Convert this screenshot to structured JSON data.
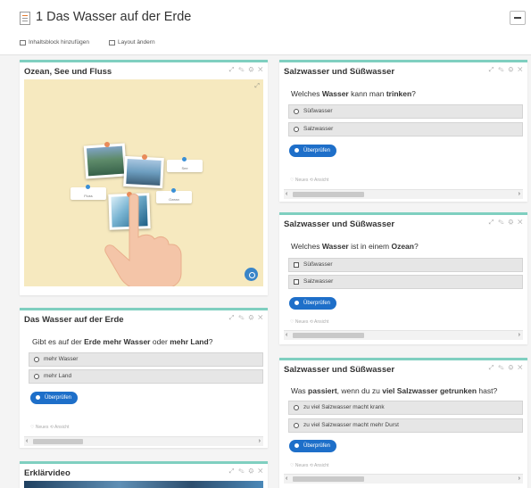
{
  "header": {
    "title": "1 Das Wasser auf der Erde",
    "add_block_label": "Inhaltsblock hinzufügen",
    "change_layout_label": "Layout ändern"
  },
  "card_tools_glyphs": "⤢ ✎ ⚙ ✕",
  "common": {
    "check_label": "Überprüfen",
    "meta_label": "♡ Neues   ⟲ Ansicht"
  },
  "cards": {
    "ocean": {
      "title": "Ozean, See und Fluss",
      "fullscreen_glyph": "⤢",
      "hotspots": [
        "See",
        "Fluss",
        "Ozean"
      ]
    },
    "earth": {
      "title": "Das Wasser auf der Erde",
      "question_parts": [
        "Gibt es auf der ",
        "Erde",
        " ",
        "mehr Wasser",
        " oder ",
        "mehr Land",
        "?"
      ],
      "options": [
        "mehr Wasser",
        "mehr Land"
      ]
    },
    "salt1": {
      "title": "Salzwasser und Süßwasser",
      "question_parts": [
        "Welches ",
        "Wasser",
        " kann man ",
        "trinken",
        "?"
      ],
      "options": [
        "Süßwasser",
        "Salzwasser"
      ]
    },
    "salt2": {
      "title": "Salzwasser und Süßwasser",
      "question_parts": [
        "Welches ",
        "Wasser",
        " ist in einem ",
        "Ozean",
        "?"
      ],
      "options": [
        "Süßwasser",
        "Salzwasser"
      ]
    },
    "salt3": {
      "title": "Salzwasser und Süßwasser",
      "question_parts": [
        "Was ",
        "passiert",
        ", wenn du zu ",
        "viel Salzwasser getrunken",
        " hast?"
      ],
      "options": [
        "zu viel Salzwasser macht krank",
        "zu viel Salzwasser macht mehr Durst"
      ]
    },
    "video": {
      "title": "Erklärvideo"
    }
  },
  "colors": {
    "accent": "#7fcfc0",
    "button": "#1e6fc9",
    "stage_background": "#f6e9bf"
  }
}
